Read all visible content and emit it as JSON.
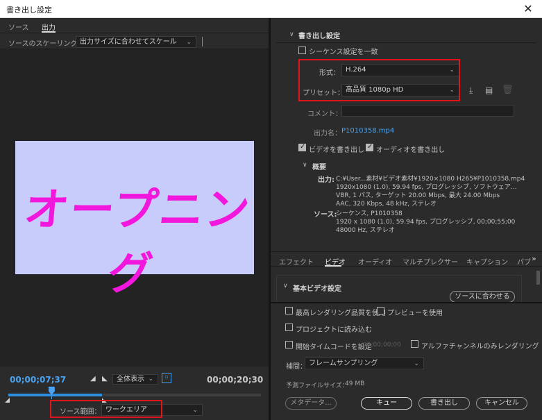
{
  "window": {
    "title": "書き出し設定",
    "close_glyph": "✕"
  },
  "left": {
    "tabs": [
      {
        "label": "ソース"
      },
      {
        "label": "出力"
      }
    ],
    "scaling_label": "ソースのスケーリング：",
    "scaling_value": "出力サイズに合わせてスケール",
    "preview_text": "オープニング",
    "timeline": {
      "current_tc": "00;00;07;37",
      "total_tc": "00;00;20;30",
      "zoom_value": "全体表示",
      "playhead_fraction": 0.17,
      "work_area_fraction": 0.37
    },
    "source_range_label": "ソース範囲：",
    "source_range_value": "ワークエリア"
  },
  "export": {
    "header": "書き出し設定",
    "match_sequence_label": "シーケンス設定を一致",
    "format_label": "形式：",
    "format_value": "H.264",
    "preset_label": "プリセット：",
    "preset_value": "高品質 1080p HD",
    "comment_label": "コメント：",
    "comment_value": "",
    "output_name_label": "出力名：",
    "output_name_value": "P1010358.mp4",
    "export_video_label": "ビデオを書き出し",
    "export_audio_label": "オーディオを書き出し",
    "summary_label": "概要",
    "output_key": "出力:",
    "output_lines": [
      "C:¥User...素材¥ビデオ素材¥1920×1080 H265¥P1010358.mp4",
      "1920x1080 (1.0), 59.94 fps, プログレッシブ, ソフトウェア…",
      "VBR, 1 パス, ターゲット 20.00 Mbps, 最大 24.00 Mbps",
      "AAC, 320 Kbps, 48 kHz, ステレオ"
    ],
    "source_key": "ソース:",
    "source_lines": [
      "シーケンス, P1010358",
      "1920 x 1080 (1.0), 59.94 fps, プログレッシブ, 00;00;55;00",
      "48000 Hz, ステレオ"
    ]
  },
  "right_tabs": {
    "items": [
      "エフェクト",
      "ビデオ",
      "オーディオ",
      "マルチプレクサー",
      "キャプション",
      "パブ"
    ],
    "more_glyph": "»"
  },
  "video_section": {
    "header": "基本ビデオ設定",
    "match_source_label": "ソースに合わせる"
  },
  "bottom": {
    "max_quality_label": "最高レンダリング品質を使用",
    "use_preview_label": "プレビューを使用",
    "import_project_label": "プロジェクトに読み込む",
    "start_tc_label": "開始タイムコードを設定",
    "start_tc_value": "00;00;00;00",
    "alpha_only_label": "アルファチャンネルのみレンダリング",
    "interp_label": "補間：",
    "interp_value": "フレームサンプリング",
    "filesize_label": "予測ファイルサイズ：",
    "filesize_value": "49 MB",
    "metadata_button": "メタデータ...",
    "queue_button": "キュー",
    "export_button": "書き出し",
    "cancel_button": "キャンセル"
  },
  "icons": {
    "in_mark": "◢",
    "out_mark": "◣",
    "fit": "⌗",
    "save_preset": "⤓",
    "import_preset": "▤",
    "delete_preset": "🗑",
    "chevron_down": "⌄",
    "section_chevron": "∨"
  },
  "colors": {
    "accent": "#4aa2f0",
    "highlight": "#e0151b",
    "preview_bg": "#c8ccfa",
    "preview_text": "#f217dc"
  }
}
